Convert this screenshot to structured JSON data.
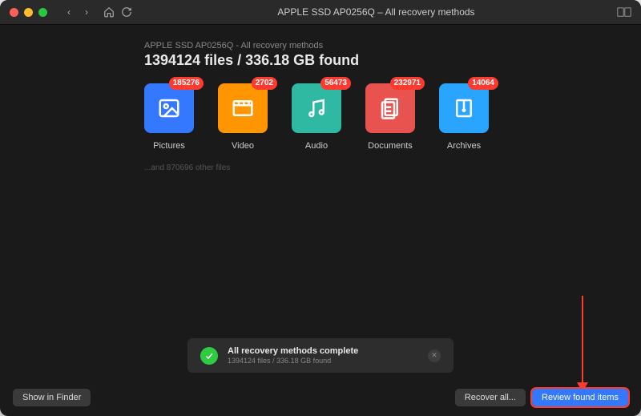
{
  "window_title": "APPLE SSD AP0256Q – All recovery methods",
  "header": {
    "subtitle": "APPLE SSD AP0256Q - All recovery methods",
    "headline": "1394124 files / 336.18 GB found"
  },
  "categories": [
    {
      "name": "Pictures",
      "count": "185276",
      "color": "#3478ff",
      "icon": "picture-icon"
    },
    {
      "name": "Video",
      "count": "2702",
      "color": "#ff9500",
      "icon": "video-icon"
    },
    {
      "name": "Audio",
      "count": "56473",
      "color": "#2fb8a2",
      "icon": "audio-icon"
    },
    {
      "name": "Documents",
      "count": "232971",
      "color": "#e8524f",
      "icon": "document-icon"
    },
    {
      "name": "Archives",
      "count": "14064",
      "color": "#2aa5ff",
      "icon": "archive-icon"
    }
  ],
  "other_files_text": "...and 870696 other files",
  "status": {
    "title": "All recovery methods complete",
    "subtitle": "1394124 files / 336.18 GB found"
  },
  "buttons": {
    "show_in_finder": "Show in Finder",
    "recover_all": "Recover all...",
    "review": "Review found items"
  },
  "traffic": {
    "close": "#ff5f57",
    "min": "#febc2e",
    "max": "#28c840"
  }
}
